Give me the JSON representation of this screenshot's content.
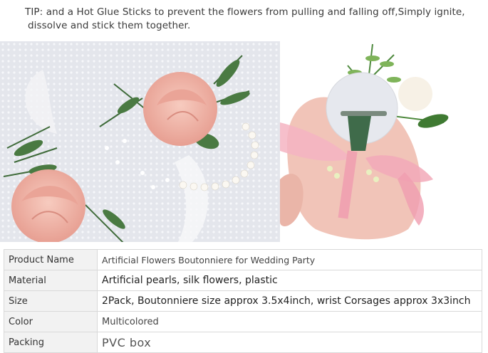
{
  "tip": {
    "line1": "TIP: and a Hot Glue Sticks to prevent the flowers from pulling and falling off,Simply ignite,",
    "line2": "dissolve and stick them together."
  },
  "images": {
    "left": "wrist-corsage-photo",
    "right": "boutonniere-back-pin-photo"
  },
  "colors": {
    "rose": "#f0b5a8",
    "leaf": "#3f6b3a",
    "lace": "#e6e8ee",
    "ribbon": "#f2a9b8",
    "table_label_bg": "#f2f2f2",
    "table_border": "#d9d9d9"
  },
  "specs": [
    {
      "label": "Product Name",
      "value": "Artificial Flowers Boutonniere for Wedding Party"
    },
    {
      "label": "Material",
      "value": "Artificial pearls, silk flowers, plastic"
    },
    {
      "label": "Size",
      "value": "2Pack, Boutonniere size approx 3.5x4inch, wrist Corsages approx 3x3inch"
    },
    {
      "label": "Color",
      "value": "Multicolored"
    },
    {
      "label": "Packing",
      "value": "PVC box"
    }
  ]
}
